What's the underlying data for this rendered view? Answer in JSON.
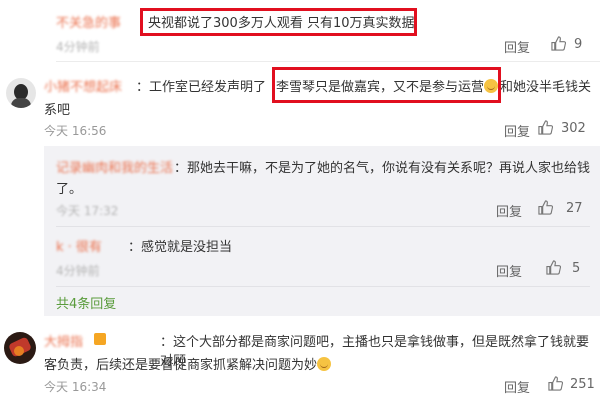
{
  "comment1": {
    "username": "不关急的事",
    "text": "央视都说了300多万人观看 只有10万真实数据",
    "time": "4分钟前",
    "reply": "回复",
    "likes": "9"
  },
  "comment2": {
    "username": "小猪不想起床",
    "text_pre": "：工作室已经发声明了",
    "text_boxed": "李雪琴只是做嘉宾，又不是参与运营",
    "text_post": "和她没半毛钱关",
    "text_line2": "系吧",
    "time": "今天 16:56",
    "reply": "回复",
    "likes": "302"
  },
  "reply1": {
    "username": "记录幽肉和我的生活",
    "text": "：那她去干嘛，不是为了她的名气，你说有没有关系呢？再说人家也给钱",
    "text_line2": "了。",
    "time": "今天 17:32",
    "reply": "回复",
    "likes": "27"
  },
  "reply2": {
    "username": "k · 很有",
    "text": "：感觉就是没担当",
    "time": "4分钟前",
    "reply": "回复",
    "likes": "5"
  },
  "more_replies": "共4条回复",
  "comment3": {
    "username": "大拇指",
    "text": "：这个大部分都是商家问题吧，主播也只是拿钱做事，但是既然拿了钱就要对顾",
    "text_line2": "客负责，后续还是要督促商家抓紧解决问题为妙",
    "time": "今天 16:34",
    "reply": "回复",
    "likes": "251"
  },
  "colors": {
    "highlight_box": "#e10f1f",
    "link": "#eb7350",
    "reply_count": "#5a9c3c"
  }
}
